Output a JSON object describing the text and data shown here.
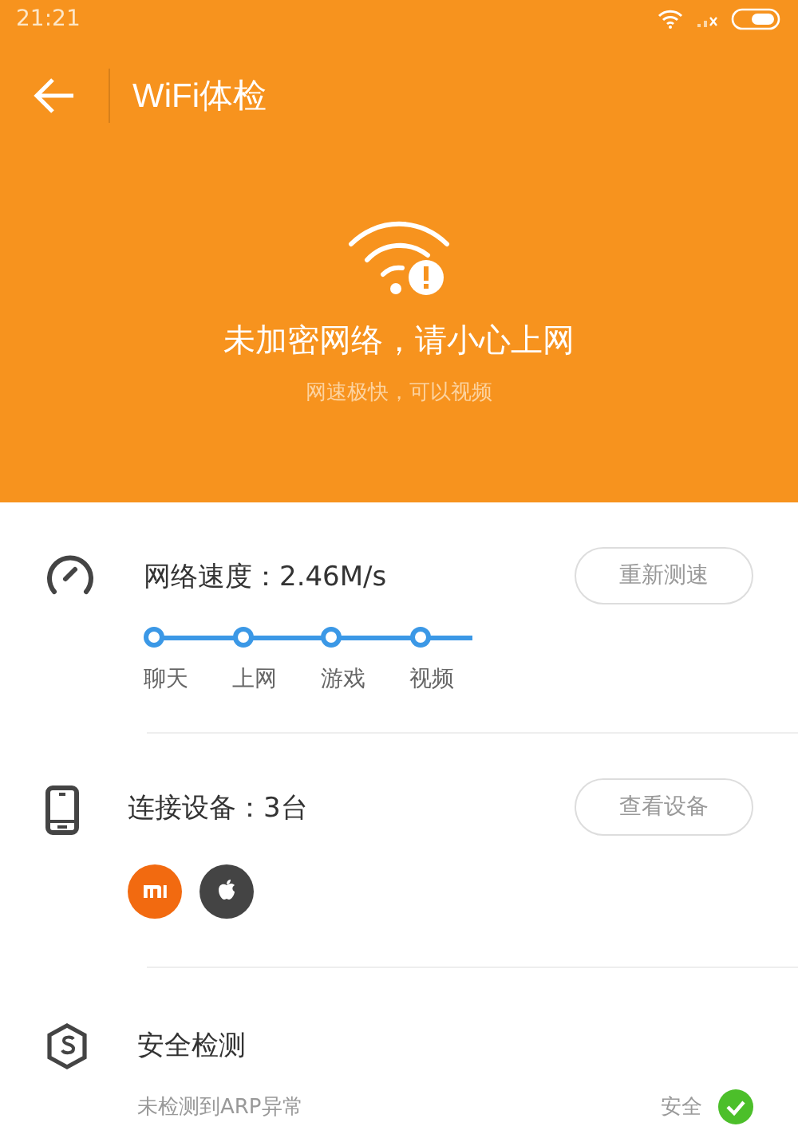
{
  "status_bar": {
    "time": "21:21"
  },
  "toolbar": {
    "title": "WiFi体检"
  },
  "banner": {
    "title": "未加密网络，请小心上网",
    "subtitle": "网速极快，可以视频"
  },
  "speed": {
    "title": "网络速度：2.46M/s",
    "button": "重新测速",
    "levels": [
      {
        "label": "聊天"
      },
      {
        "label": "上网"
      },
      {
        "label": "游戏"
      },
      {
        "label": "视频"
      }
    ]
  },
  "devices": {
    "title": "连接设备：3台",
    "button": "查看设备",
    "items": [
      {
        "kind": "xiaomi"
      },
      {
        "kind": "apple"
      }
    ]
  },
  "security": {
    "title": "安全检测",
    "checks": [
      {
        "label": "未检测到ARP异常",
        "result": "安全",
        "passed": true
      }
    ]
  }
}
